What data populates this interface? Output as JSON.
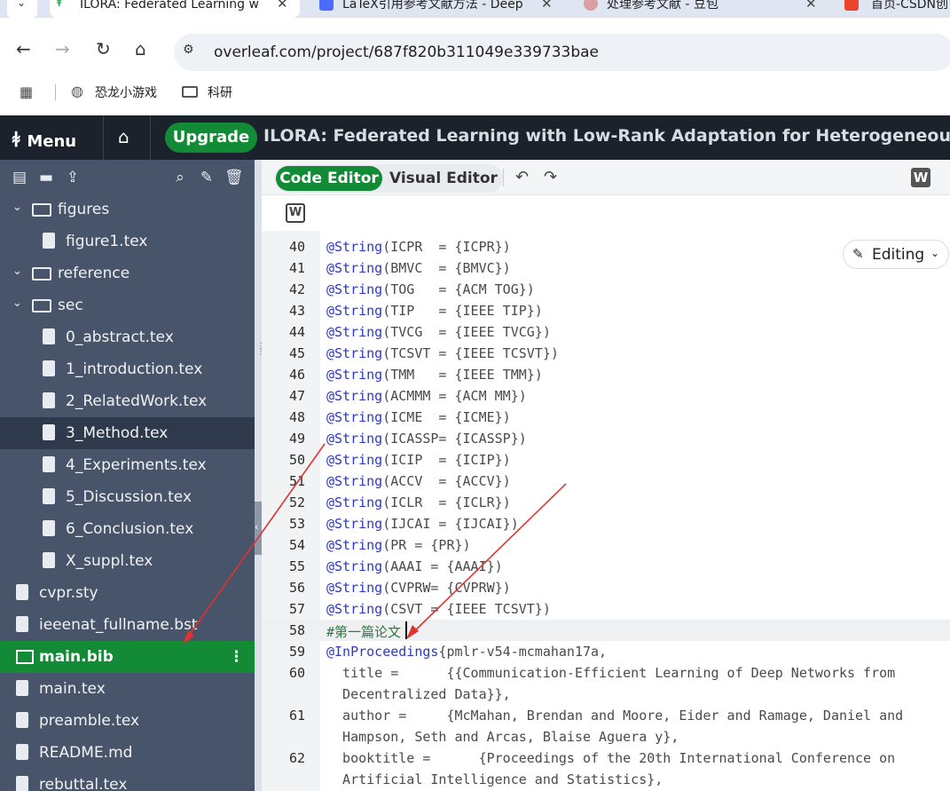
{
  "browser": {
    "tabs": [
      {
        "title": "ILORA: Federated Learning w",
        "active": true
      },
      {
        "title": "LaTeX引用参考文献方法 - Deep",
        "active": false
      },
      {
        "title": "处理参考文献 - 豆包",
        "active": false
      },
      {
        "title": "首页-CSDN创",
        "active": false
      }
    ],
    "url": "overleaf.com/project/687f820b311049e339733bae",
    "bookmarks": [
      "恐龙小游戏",
      "科研"
    ]
  },
  "overleaf": {
    "menu_label": "Menu",
    "upgrade_label": "Upgrade",
    "project_title": "ILORA: Federated Learning with Low-Rank Adaptation for Heterogeneous Client",
    "sidebar": {
      "rows": [
        {
          "label": "figures",
          "type": "folder"
        },
        {
          "label": "figure1.tex",
          "type": "file"
        },
        {
          "label": "reference",
          "type": "folder"
        },
        {
          "label": "sec",
          "type": "folder"
        },
        {
          "label": "0_abstract.tex",
          "type": "file"
        },
        {
          "label": "1_introduction.tex",
          "type": "file"
        },
        {
          "label": "2_RelatedWork.tex",
          "type": "file"
        },
        {
          "label": "3_Method.tex",
          "type": "file"
        },
        {
          "label": "4_Experiments.tex",
          "type": "file"
        },
        {
          "label": "5_Discussion.tex",
          "type": "file"
        },
        {
          "label": "6_Conclusion.tex",
          "type": "file"
        },
        {
          "label": "X_suppl.tex",
          "type": "file"
        },
        {
          "label": "cvpr.sty",
          "type": "file"
        },
        {
          "label": "ieeenat_fullname.bst",
          "type": "file"
        },
        {
          "label": "main.bib",
          "type": "bib"
        },
        {
          "label": "main.tex",
          "type": "file"
        },
        {
          "label": "preamble.tex",
          "type": "file"
        },
        {
          "label": "README.md",
          "type": "file"
        },
        {
          "label": "rebuttal.tex",
          "type": "file"
        }
      ]
    },
    "editor": {
      "code_editor_label": "Code Editor",
      "visual_editor_label": "Visual Editor",
      "editing_label": "Editing",
      "lines": [
        {
          "n": "40",
          "kw": "@String",
          "rest": "(ICPR  = {ICPR})"
        },
        {
          "n": "41",
          "kw": "@String",
          "rest": "(BMVC  = {BMVC})"
        },
        {
          "n": "42",
          "kw": "@String",
          "rest": "(TOG   = {ACM TOG})"
        },
        {
          "n": "43",
          "kw": "@String",
          "rest": "(TIP   = {IEEE TIP})"
        },
        {
          "n": "44",
          "kw": "@String",
          "rest": "(TVCG  = {IEEE TVCG})"
        },
        {
          "n": "45",
          "kw": "@String",
          "rest": "(TCSVT = {IEEE TCSVT})"
        },
        {
          "n": "46",
          "kw": "@String",
          "rest": "(TMM   = {IEEE TMM})"
        },
        {
          "n": "47",
          "kw": "@String",
          "rest": "(ACMMM = {ACM MM})"
        },
        {
          "n": "48",
          "kw": "@String",
          "rest": "(ICME  = {ICME})"
        },
        {
          "n": "49",
          "kw": "@String",
          "rest": "(ICASSP= {ICASSP})"
        },
        {
          "n": "50",
          "kw": "@String",
          "rest": "(ICIP  = {ICIP})"
        },
        {
          "n": "51",
          "kw": "@String",
          "rest": "(ACCV  = {ACCV})"
        },
        {
          "n": "52",
          "kw": "@String",
          "rest": "(ICLR  = {ICLR})"
        },
        {
          "n": "53",
          "kw": "@String",
          "rest": "(IJCAI = {IJCAI})"
        },
        {
          "n": "54",
          "kw": "@String",
          "rest": "(PR = {PR})"
        },
        {
          "n": "55",
          "kw": "@String",
          "rest": "(AAAI = {AAAI})"
        },
        {
          "n": "56",
          "kw": "@String",
          "rest": "(CVPRW= {CVPRW})"
        },
        {
          "n": "57",
          "kw": "@String",
          "rest": "(CSVT = {IEEE TCSVT})"
        },
        {
          "n": "58",
          "kw": "",
          "rest": "#第一篇论文",
          "comment": true
        },
        {
          "n": "59",
          "kw": "@InProceedings",
          "rest": "{pmlr-v54-mcmahan17a,"
        },
        {
          "n": "60",
          "kw": "",
          "rest": "  title =      {{Communication-Efficient Learning of Deep Networks from"
        },
        {
          "n": "",
          "kw": "",
          "rest": "  Decentralized Data}},"
        },
        {
          "n": "61",
          "kw": "",
          "rest": "  author =     {McMahan, Brendan and Moore, Eider and Ramage, Daniel and"
        },
        {
          "n": "",
          "kw": "",
          "rest": "  Hampson, Seth and Arcas, Blaise Aguera y},"
        },
        {
          "n": "62",
          "kw": "",
          "rest": "  booktitle =      {Proceedings of the 20th International Conference on"
        },
        {
          "n": "",
          "kw": "",
          "rest": "  Artificial Intelligence and Statistics},"
        }
      ]
    }
  },
  "colors": {
    "overleaf_green": "#138a36",
    "sidebar_bg": "#485469",
    "header_bg": "#1b222c",
    "keyword_blue": "#2c39c4",
    "annotation_red": "#e0322f"
  }
}
